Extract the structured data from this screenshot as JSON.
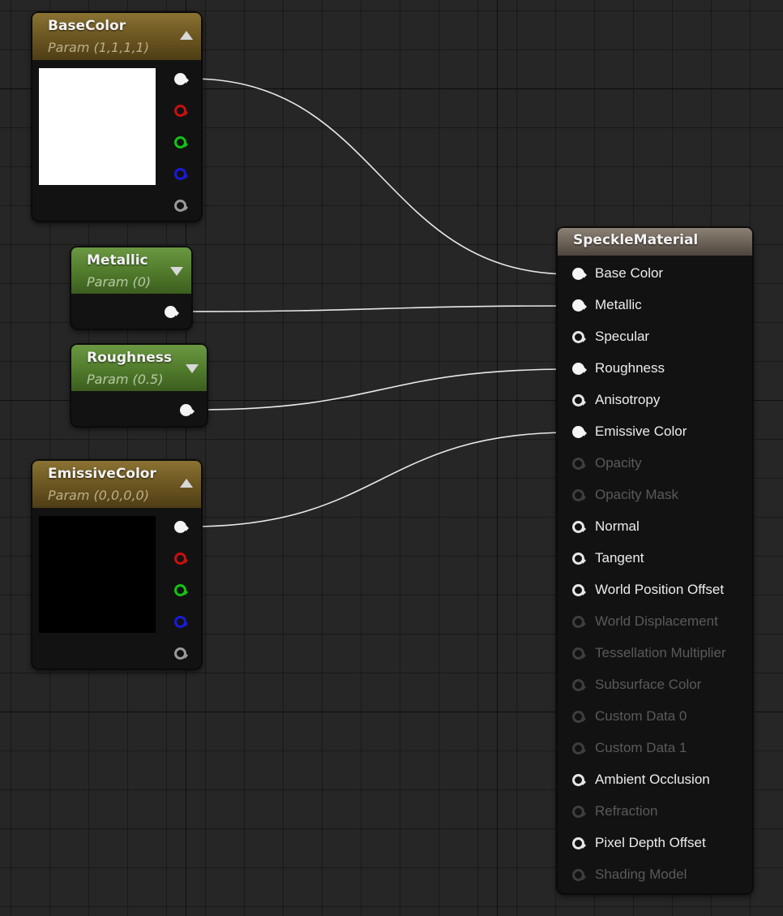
{
  "nodes": {
    "base_color": {
      "title": "BaseColor",
      "subtitle": "Param (1,1,1,1)",
      "preview_color": "#ffffff",
      "header_color": "#7a632a"
    },
    "metallic": {
      "title": "Metallic",
      "subtitle": "Param (0)",
      "header_color": "#5c8a35"
    },
    "roughness": {
      "title": "Roughness",
      "subtitle": "Param (0.5)",
      "header_color": "#5c8a35"
    },
    "emissive_color": {
      "title": "EmissiveColor",
      "subtitle": "Param (0,0,0,0)",
      "preview_color": "#000000",
      "header_color": "#7a632a"
    },
    "material": {
      "title": "SpeckleMaterial",
      "header_color": "#7a6f64",
      "inputs": [
        {
          "label": "Base Color",
          "connected": true,
          "enabled": true
        },
        {
          "label": "Metallic",
          "connected": true,
          "enabled": true
        },
        {
          "label": "Specular",
          "connected": false,
          "enabled": true
        },
        {
          "label": "Roughness",
          "connected": true,
          "enabled": true
        },
        {
          "label": "Anisotropy",
          "connected": false,
          "enabled": true
        },
        {
          "label": "Emissive Color",
          "connected": true,
          "enabled": true
        },
        {
          "label": "Opacity",
          "connected": false,
          "enabled": false
        },
        {
          "label": "Opacity Mask",
          "connected": false,
          "enabled": false
        },
        {
          "label": "Normal",
          "connected": false,
          "enabled": true
        },
        {
          "label": "Tangent",
          "connected": false,
          "enabled": true
        },
        {
          "label": "World Position Offset",
          "connected": false,
          "enabled": true
        },
        {
          "label": "World Displacement",
          "connected": false,
          "enabled": false
        },
        {
          "label": "Tessellation Multiplier",
          "connected": false,
          "enabled": false
        },
        {
          "label": "Subsurface Color",
          "connected": false,
          "enabled": false
        },
        {
          "label": "Custom Data 0",
          "connected": false,
          "enabled": false
        },
        {
          "label": "Custom Data 1",
          "connected": false,
          "enabled": false
        },
        {
          "label": "Ambient Occlusion",
          "connected": false,
          "enabled": true
        },
        {
          "label": "Refraction",
          "connected": false,
          "enabled": false
        },
        {
          "label": "Pixel Depth Offset",
          "connected": false,
          "enabled": true
        },
        {
          "label": "Shading Model",
          "connected": false,
          "enabled": false
        }
      ]
    }
  },
  "pin_colors": {
    "rgba": "#f4f4f4",
    "r": "#c81010",
    "g": "#14c214",
    "b": "#1a1ad8",
    "a": "#9a9a9a"
  },
  "icons": {
    "expand": "triangle-up-icon",
    "collapse": "triangle-down-icon",
    "pin": "exec-pin-icon"
  }
}
